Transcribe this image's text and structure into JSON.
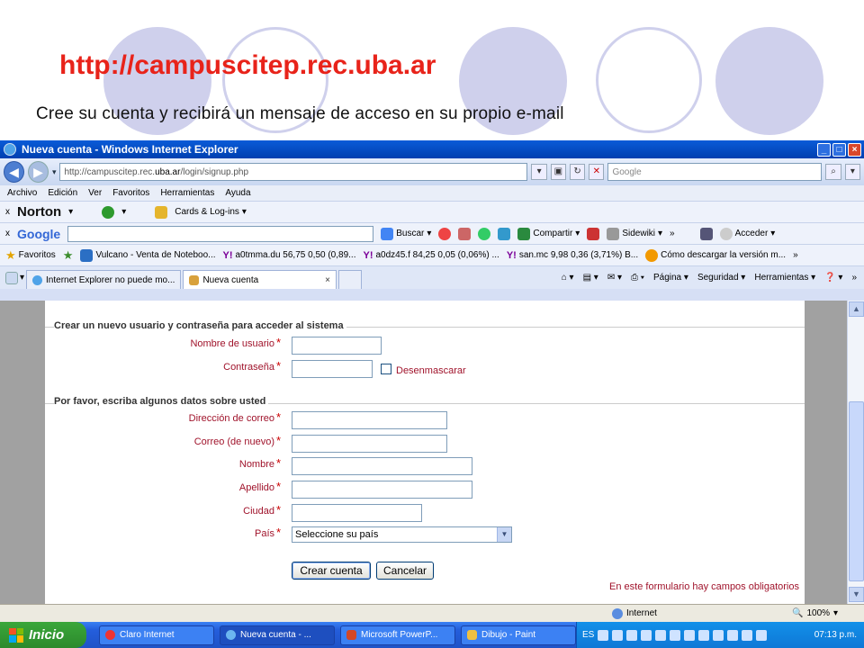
{
  "slide": {
    "url": "http://campuscitep.rec.uba.ar",
    "subtitle": "Cree su cuenta y recibirá un mensaje de acceso en su propio e-mail"
  },
  "window": {
    "title": "Nueva cuenta - Windows Internet Explorer",
    "address_prefix": "http://campuscitep.rec.",
    "address_highlight": "uba.ar",
    "address_suffix": "/login/signup.php",
    "search_placeholder": "Google",
    "controls": {
      "minimize": "_",
      "maximize": "□",
      "close": "×"
    }
  },
  "menu": [
    "Archivo",
    "Edición",
    "Ver",
    "Favoritos",
    "Herramientas",
    "Ayuda"
  ],
  "norton_toolbar": {
    "close": "x",
    "logo": "Norton",
    "cards": "Cards & Log-ins"
  },
  "google_toolbar": {
    "close": "x",
    "logo": "Google",
    "buscar": "Buscar",
    "compartir": "Compartir",
    "sidewiki": "Sidewiki",
    "more": "»",
    "acceder": "Acceder"
  },
  "favorites_bar": {
    "label": "Favoritos",
    "items": [
      "Vulcano - Venta de Noteboo...",
      "a0tmma.du 56,75 0,50 (0,89...",
      "a0dz45.f 84,25 0,05 (0,06%) ...",
      "san.mc 9,98 0,36 (3,71%)  B...",
      "Cómo descargar la versión m..."
    ],
    "more": "»"
  },
  "tabs": {
    "items": [
      "Internet Explorer no puede mo...",
      "Nueva cuenta"
    ],
    "close": "×",
    "right": [
      "Página",
      "Seguridad",
      "Herramientas"
    ],
    "more": "»"
  },
  "form": {
    "section1": "Crear un nuevo usuario y contraseña para acceder al sistema",
    "username_label": "Nombre de usuario",
    "password_label": "Contraseña",
    "unmask_label": "Desenmascarar",
    "section2": "Por favor, escriba algunos datos sobre usted",
    "email_label": "Dirección de correo",
    "email2_label": "Correo (de nuevo)",
    "firstname_label": "Nombre",
    "lastname_label": "Apellido",
    "city_label": "Ciudad",
    "country_label": "País",
    "country_value": "Seleccione su país",
    "required_mark": "*",
    "submit": "Crear cuenta",
    "cancel": "Cancelar",
    "required_note": "En este formulario hay campos obligatorios"
  },
  "status": {
    "zone": "Internet",
    "zoom": "100%"
  },
  "taskbar": {
    "start": "Inicio",
    "tasks": [
      "Claro Internet",
      "Nueva cuenta - ...",
      "Microsoft PowerP...",
      "Dibujo - Paint"
    ],
    "lang": "ES",
    "clock": "07:13 p.m."
  }
}
